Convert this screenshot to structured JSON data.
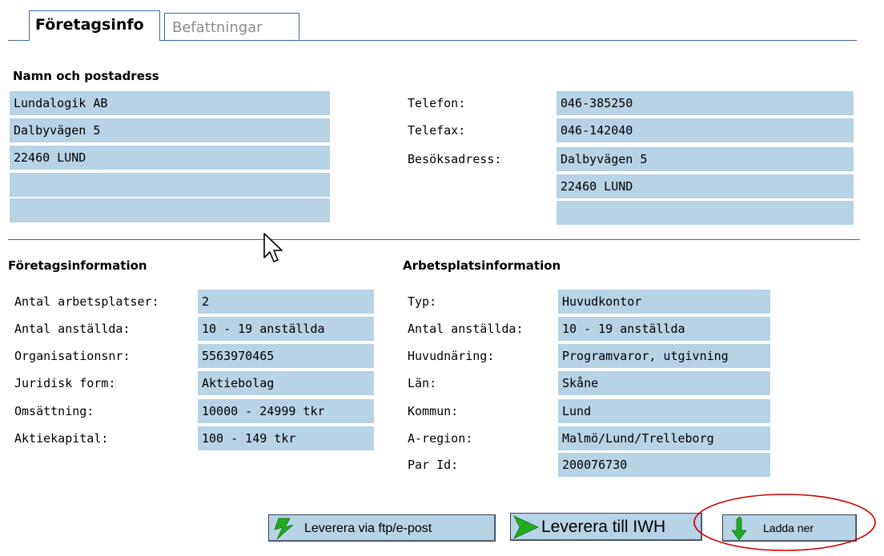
{
  "tabs": [
    {
      "label": "Företagsinfo"
    },
    {
      "label": "Befattningar"
    }
  ],
  "address": {
    "heading": "Namn och postadress",
    "lines": [
      "Lundalogik AB",
      "Dalbyvägen 5",
      "22460 LUND",
      "",
      ""
    ]
  },
  "contact": {
    "telefon_label": "Telefon:",
    "telefon": "046-385250",
    "telefax_label": "Telefax:",
    "telefax": "046-142040",
    "besok_label": "Besöksadress:",
    "besok_lines": [
      "Dalbyvägen 5",
      "22460 LUND",
      ""
    ]
  },
  "company_info": {
    "heading": "Företagsinformation",
    "rows": [
      {
        "label": "Antal arbetsplatser:",
        "value": "2"
      },
      {
        "label": "Antal anställda:",
        "value": "10 - 19 anställda"
      },
      {
        "label": "Organisationsnr:",
        "value": "5563970465"
      },
      {
        "label": "Juridisk form:",
        "value": "Aktiebolag"
      },
      {
        "label": "Omsättning:",
        "value": "10000 - 24999 tkr"
      },
      {
        "label": "Aktiekapital:",
        "value": "100 - 149 tkr"
      }
    ]
  },
  "workplace_info": {
    "heading": "Arbetsplatsinformation",
    "rows": [
      {
        "label": "Typ:",
        "value": "Huvudkontor"
      },
      {
        "label": "Antal anställda:",
        "value": "10 - 19 anställda"
      },
      {
        "label": "Huvudnäring:",
        "value": "Programvaror, utgivning"
      },
      {
        "label": "Län:",
        "value": "Skåne"
      },
      {
        "label": "Kommun:",
        "value": "Lund"
      },
      {
        "label": "A-region:",
        "value": "Malmö/Lund/Trelleborg"
      },
      {
        "label": "Par Id:",
        "value": "200076730"
      }
    ]
  },
  "buttons": {
    "ftp_label": "Leverera via ftp/e-post",
    "iwh_label": "Leverera till IWH",
    "download_label": "Ladda ner"
  },
  "colors": {
    "field_bg": "#b7d3e6",
    "line": "#3d6aa0",
    "icon_green": "#22aa22",
    "highlight_ellipse": "#cc0000"
  },
  "icons": [
    "flash-icon",
    "arrow-right-icon",
    "download-arrow-icon",
    "mouse-cursor-icon"
  ]
}
